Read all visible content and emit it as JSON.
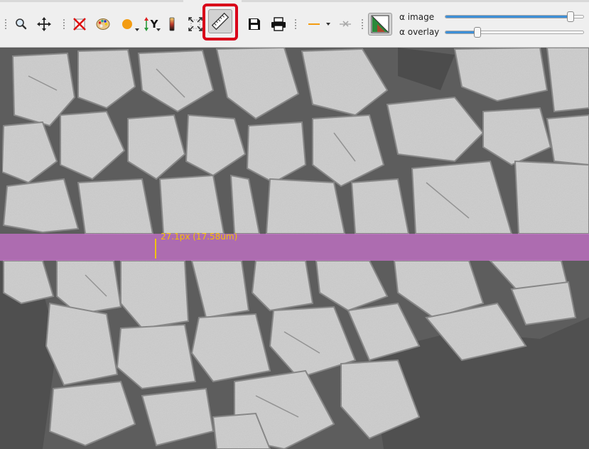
{
  "toolbar": {
    "tools": [
      {
        "name": "zoom-tool",
        "icon": "magnifier-icon"
      },
      {
        "name": "pan-tool",
        "icon": "move-arrows-icon"
      },
      {
        "name": "clear-overlay-tool",
        "icon": "red-cross-icon"
      },
      {
        "name": "palette-tool",
        "icon": "palette-icon"
      },
      {
        "name": "color-tool",
        "icon": "orange-dot-icon"
      },
      {
        "name": "flip-y-tool",
        "icon": "flip-y-icon"
      },
      {
        "name": "colorbar-tool",
        "icon": "colorbar-icon"
      },
      {
        "name": "fit-view-tool",
        "icon": "expand-arrows-icon"
      },
      {
        "name": "ruler-tool",
        "icon": "ruler-icon",
        "active": true
      },
      {
        "name": "save-tool",
        "icon": "floppy-disk-icon"
      },
      {
        "name": "print-tool",
        "icon": "printer-icon"
      },
      {
        "name": "line-style-tool",
        "icon": "orange-line-icon"
      },
      {
        "name": "marker-tool",
        "icon": "x-marker-icon"
      },
      {
        "name": "colormap-tool",
        "icon": "colormap-triangle-icon"
      }
    ],
    "alpha_image_label": "α image",
    "alpha_overlay_label": "α overlay",
    "alpha_image_value": 0.93,
    "alpha_overlay_value": 0.22,
    "flip_label": "Y",
    "accent_color": "#3d8fd7",
    "highlight_color": "#d9001a"
  },
  "viewer": {
    "measurement_label": "27.1px (17.58um)",
    "overlay_color": "#de76e4",
    "measurement_color": "#f2c200"
  }
}
